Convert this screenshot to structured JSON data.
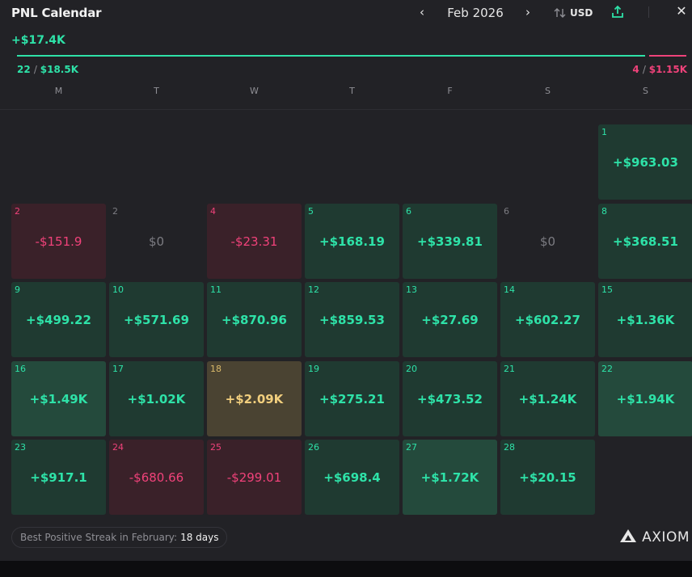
{
  "header": {
    "title": "PNL Calendar",
    "month": "Feb 2026",
    "prev_label": "‹",
    "next_label": "›",
    "currency": "USD",
    "close_label": "✕"
  },
  "summary": {
    "total": "+$17.4K",
    "positive_days": "22",
    "positive_amount": "$18.5K",
    "negative_days": "4",
    "negative_amount": "$1.15K",
    "positive_fraction": 0.94
  },
  "weekdays": [
    "M",
    "T",
    "W",
    "T",
    "F",
    "S",
    "S"
  ],
  "days": [
    {
      "day": "1",
      "value": "+$963.03",
      "kind": "pos",
      "col": 6,
      "row": 0
    },
    {
      "day": "2",
      "value": "-$151.9",
      "kind": "neg",
      "col": 0,
      "row": 1
    },
    {
      "day": "2",
      "value": "$0",
      "kind": "zero",
      "col": 1,
      "row": 1
    },
    {
      "day": "4",
      "value": "-$23.31",
      "kind": "neg",
      "col": 2,
      "row": 1
    },
    {
      "day": "5",
      "value": "+$168.19",
      "kind": "pos",
      "col": 3,
      "row": 1
    },
    {
      "day": "6",
      "value": "+$339.81",
      "kind": "pos",
      "col": 4,
      "row": 1
    },
    {
      "day": "6",
      "value": "$0",
      "kind": "zero",
      "col": 5,
      "row": 1
    },
    {
      "day": "8",
      "value": "+$368.51",
      "kind": "pos",
      "col": 6,
      "row": 1
    },
    {
      "day": "9",
      "value": "+$499.22",
      "kind": "pos",
      "col": 0,
      "row": 2
    },
    {
      "day": "10",
      "value": "+$571.69",
      "kind": "pos",
      "col": 1,
      "row": 2
    },
    {
      "day": "11",
      "value": "+$870.96",
      "kind": "pos",
      "col": 2,
      "row": 2
    },
    {
      "day": "12",
      "value": "+$859.53",
      "kind": "pos",
      "col": 3,
      "row": 2
    },
    {
      "day": "13",
      "value": "+$27.69",
      "kind": "pos",
      "col": 4,
      "row": 2
    },
    {
      "day": "14",
      "value": "+$602.27",
      "kind": "pos",
      "col": 5,
      "row": 2
    },
    {
      "day": "15",
      "value": "+$1.36K",
      "kind": "pos",
      "col": 6,
      "row": 2
    },
    {
      "day": "16",
      "value": "+$1.49K",
      "kind": "pos-hi",
      "col": 0,
      "row": 3
    },
    {
      "day": "17",
      "value": "+$1.02K",
      "kind": "pos",
      "col": 1,
      "row": 3
    },
    {
      "day": "18",
      "value": "+$2.09K",
      "kind": "best",
      "col": 2,
      "row": 3
    },
    {
      "day": "19",
      "value": "+$275.21",
      "kind": "pos",
      "col": 3,
      "row": 3
    },
    {
      "day": "20",
      "value": "+$473.52",
      "kind": "pos",
      "col": 4,
      "row": 3
    },
    {
      "day": "21",
      "value": "+$1.24K",
      "kind": "pos",
      "col": 5,
      "row": 3
    },
    {
      "day": "22",
      "value": "+$1.94K",
      "kind": "pos-hi",
      "col": 6,
      "row": 3
    },
    {
      "day": "23",
      "value": "+$917.1",
      "kind": "pos",
      "col": 0,
      "row": 4
    },
    {
      "day": "24",
      "value": "-$680.66",
      "kind": "neg",
      "col": 1,
      "row": 4
    },
    {
      "day": "25",
      "value": "-$299.01",
      "kind": "neg",
      "col": 2,
      "row": 4
    },
    {
      "day": "26",
      "value": "+$698.4",
      "kind": "pos",
      "col": 3,
      "row": 4
    },
    {
      "day": "27",
      "value": "+$1.72K",
      "kind": "pos-hi",
      "col": 4,
      "row": 4
    },
    {
      "day": "28",
      "value": "+$20.15",
      "kind": "pos",
      "col": 5,
      "row": 4
    }
  ],
  "footer": {
    "streak_label": "Best Positive Streak in February:",
    "streak_value": "18 days",
    "brand": "AXIOM"
  },
  "icons": {
    "prev": "chevron-left-icon",
    "next": "chevron-right-icon",
    "sort": "sort-arrows-icon",
    "share": "share-upload-icon",
    "close": "close-icon",
    "brand": "axiom-logo-icon"
  },
  "colors": {
    "positive": "#2ee2a8",
    "negative": "#f0427a",
    "best_day": "#f2cf7e",
    "panel_bg": "#222226"
  }
}
